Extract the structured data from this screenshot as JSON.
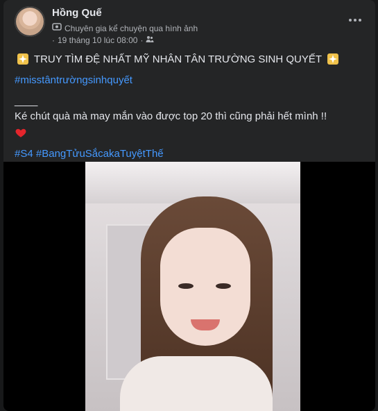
{
  "post": {
    "author": "Hồng Quế",
    "badge": "Chuyên gia kể chuyện qua hình ảnh",
    "time": "19 tháng 10 lúc 08:00",
    "separator": "·",
    "title_line": "TRUY TÌM ĐỆ NHẤT MỸ NHÂN TÂN TRƯỜNG SINH QUYẾT",
    "hashtag1": "#misstântrườngsinhquyết",
    "divider_text": "____",
    "body_line": "Ké chút quà mà may mắn vào được top 20 thì cũng phải hết mình !!",
    "hashtag2": "#S4",
    "hashtag3": "#BangTửuSắcakaTuyệtThế"
  },
  "icons": {
    "more": "more-options-icon",
    "badge": "expert-badge-icon",
    "privacy": "friends-privacy-icon",
    "emoji_star": "sparkle-icon",
    "emoji_heart": "heart-icon"
  },
  "colors": {
    "background": "#18191a",
    "card": "#242526",
    "text": "#e4e6eb",
    "muted": "#b0b3b8",
    "link": "#4599ff"
  }
}
